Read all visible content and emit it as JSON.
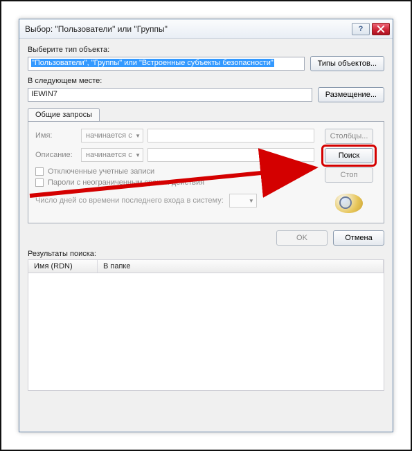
{
  "window": {
    "title": "Выбор: \"Пользователи\" или \"Группы\"",
    "help": "?",
    "close": "×"
  },
  "objectType": {
    "label": "Выберите тип объекта:",
    "value": "\"Пользователи\", \"Группы\" или \"Встроенные субъекты безопасности\"",
    "button": "Типы объектов..."
  },
  "location": {
    "label": "В следующем месте:",
    "value": "IEWIN7",
    "button": "Размещение..."
  },
  "tab": {
    "label": "Общие запросы"
  },
  "query": {
    "name_label": "Имя:",
    "desc_label": "Описание:",
    "starts_with": "начинается с",
    "chk_disabled": "Отключенные учетные записи",
    "chk_pwnever": "Пароли с неограниченным сроком действия",
    "days_label": "Число дней со времени последнего входа в систему:"
  },
  "sidebuttons": {
    "columns": "Столбцы...",
    "search": "Поиск",
    "stop": "Стоп"
  },
  "footer": {
    "ok": "OK",
    "cancel": "Отмена"
  },
  "results": {
    "label": "Результаты поиска:",
    "col_name": "Имя (RDN)",
    "col_folder": "В папке"
  }
}
